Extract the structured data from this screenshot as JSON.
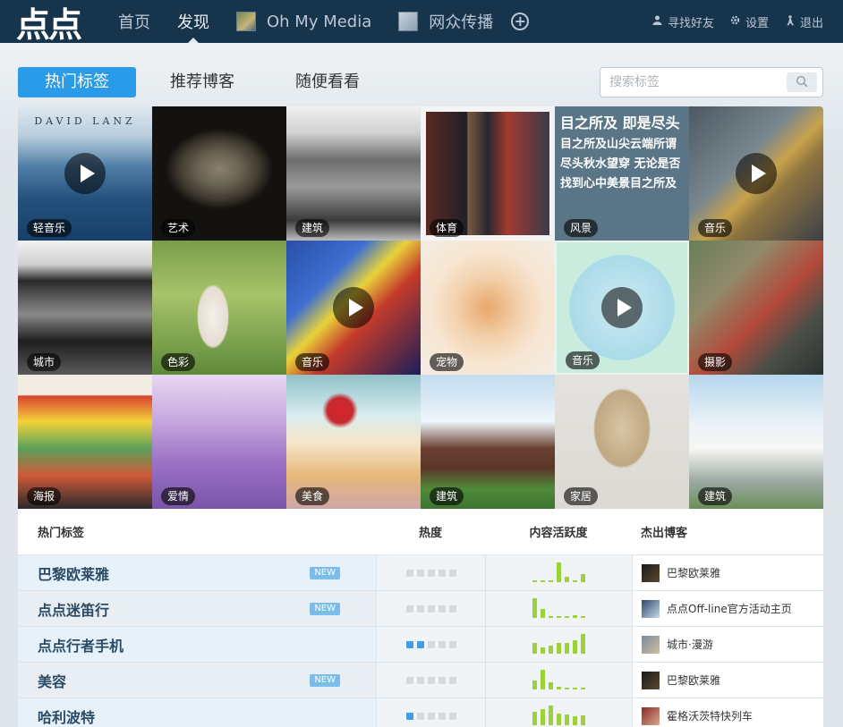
{
  "app": {
    "logo": "点点",
    "nav": [
      {
        "label": "首页",
        "active": false
      },
      {
        "label": "发现",
        "active": true
      }
    ],
    "blogs": [
      {
        "label": "Oh My Media"
      },
      {
        "label": "网众传播"
      }
    ],
    "right_links": [
      {
        "label": "寻找好友",
        "icon": "user-icon"
      },
      {
        "label": "设置",
        "icon": "gear-icon"
      },
      {
        "label": "退出",
        "icon": "logout-icon"
      }
    ]
  },
  "tabs": [
    {
      "label": "热门标签",
      "active": true
    },
    {
      "label": "推荐博客",
      "active": false
    },
    {
      "label": "随便看看",
      "active": false
    }
  ],
  "search": {
    "placeholder": "搜索标签"
  },
  "grid": [
    {
      "label": "轻音乐",
      "play": true
    },
    {
      "label": "艺术",
      "play": false
    },
    {
      "label": "建筑",
      "play": false
    },
    {
      "label": "体育",
      "play": false
    },
    {
      "label": "风景",
      "play": false,
      "text_title": "目之所及 即是尽头",
      "text_body": "目之所及山尖云端所谓尽头秋水望穿 无论是否找到心中美景目之所及"
    },
    {
      "label": "音乐",
      "play": true
    },
    {
      "label": "城市",
      "play": false
    },
    {
      "label": "色彩",
      "play": false
    },
    {
      "label": "音乐",
      "play": true
    },
    {
      "label": "宠物",
      "play": false
    },
    {
      "label": "音乐",
      "play": true
    },
    {
      "label": "摄影",
      "play": false
    },
    {
      "label": "海报",
      "play": false
    },
    {
      "label": "爱情",
      "play": false
    },
    {
      "label": "美食",
      "play": false
    },
    {
      "label": "建筑",
      "play": false
    },
    {
      "label": "家居",
      "play": false
    },
    {
      "label": "建筑",
      "play": false
    }
  ],
  "table": {
    "headers": {
      "tag": "热门标签",
      "heat": "热度",
      "activity": "内容活跃度",
      "blogger": "杰出博客"
    },
    "rows": [
      {
        "name": "巴黎欧莱雅",
        "is_new": true,
        "badge": "NEW",
        "heat": 0,
        "activity": [
          0,
          0,
          0,
          1,
          0.25,
          0,
          0.4
        ],
        "blogger": "巴黎欧莱雅"
      },
      {
        "name": "点点迷笛行",
        "is_new": true,
        "badge": "NEW",
        "heat": 0,
        "activity": [
          1,
          0.45,
          0,
          0,
          0,
          0.15,
          0
        ],
        "blogger": "点点Off-line官方活动主页"
      },
      {
        "name": "点点行者手机",
        "is_new": false,
        "badge": "",
        "heat": 2,
        "activity": [
          0.55,
          0.3,
          0.4,
          0.55,
          0.55,
          0.7,
          1
        ],
        "blogger": "城市·漫游"
      },
      {
        "name": "美容",
        "is_new": true,
        "badge": "NEW",
        "heat": 0,
        "activity": [
          0.45,
          1,
          0.35,
          0.15,
          0.1,
          0.1,
          0.05
        ],
        "blogger": "巴黎欧莱雅"
      },
      {
        "name": "哈利波特",
        "is_new": false,
        "badge": "",
        "heat": 1,
        "activity": [
          0.7,
          0.8,
          1,
          0.6,
          0.55,
          0.45,
          0.5
        ],
        "blogger": "霍格沃茨特快列车"
      }
    ]
  }
}
